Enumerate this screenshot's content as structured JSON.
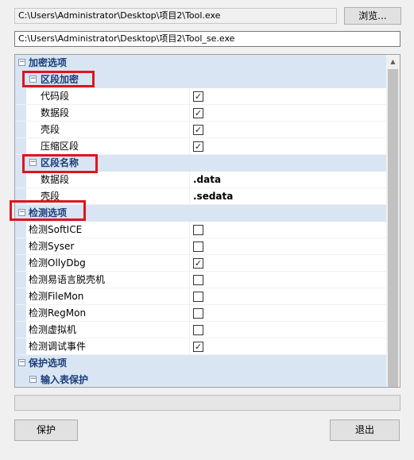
{
  "input_path": "C:\\Users\\Administrator\\Desktop\\项目2\\Tool.exe",
  "browse_label": "浏览...",
  "output_path": "C:\\Users\\Administrator\\Desktop\\项目2\\Tool_se.exe",
  "property_grid": {
    "encrypt": {
      "label": "加密选项",
      "section_encrypt": {
        "label": "区段加密",
        "items": [
          {
            "name": "代码段",
            "checked": true
          },
          {
            "name": "数据段",
            "checked": true
          },
          {
            "name": "壳段",
            "checked": true
          },
          {
            "name": "压缩区段",
            "checked": true
          }
        ]
      },
      "section_names": {
        "label": "区段名称",
        "items": [
          {
            "name": "数据段",
            "value": ".data"
          },
          {
            "name": "壳段",
            "value": ".sedata"
          }
        ]
      }
    },
    "detect": {
      "label": "检测选项",
      "items": [
        {
          "name": "检测SoftICE",
          "checked": false
        },
        {
          "name": "检测Syser",
          "checked": false
        },
        {
          "name": "检测OllyDbg",
          "checked": true
        },
        {
          "name": "检测易语言脱壳机",
          "checked": false
        },
        {
          "name": "检测FileMon",
          "checked": false
        },
        {
          "name": "检测RegMon",
          "checked": false
        },
        {
          "name": "检测虚拟机",
          "checked": false
        },
        {
          "name": "检测调试事件",
          "checked": true
        }
      ]
    },
    "protect_options": {
      "label": "保护选项",
      "import_protect": {
        "label": "输入表保护"
      }
    }
  },
  "protect_label": "保护",
  "quit_label": "退出",
  "highlight_color": "#e0141e"
}
